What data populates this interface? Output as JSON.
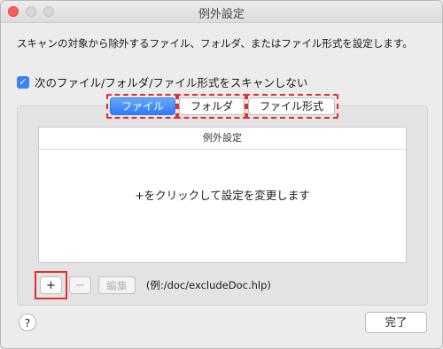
{
  "window": {
    "title": "例外設定"
  },
  "description": "スキャンの対象から除外するファイル、フォルダ、またはファイル形式を設定します。",
  "skip_checkbox": {
    "checked": true,
    "label": "次のファイル/フォルダ/ファイル形式をスキャンしない"
  },
  "tabs": [
    {
      "label": "ファイル",
      "active": true
    },
    {
      "label": "フォルダ",
      "active": false
    },
    {
      "label": "ファイル形式",
      "active": false
    }
  ],
  "table": {
    "header": "例外設定",
    "empty_message": "+をクリックして設定を変更します"
  },
  "buttons": {
    "add": "+",
    "remove": "−",
    "edit": "編集"
  },
  "example_path": "(例:/doc/excludeDoc.hlp)",
  "help_label": "?",
  "done_label": "完了"
}
